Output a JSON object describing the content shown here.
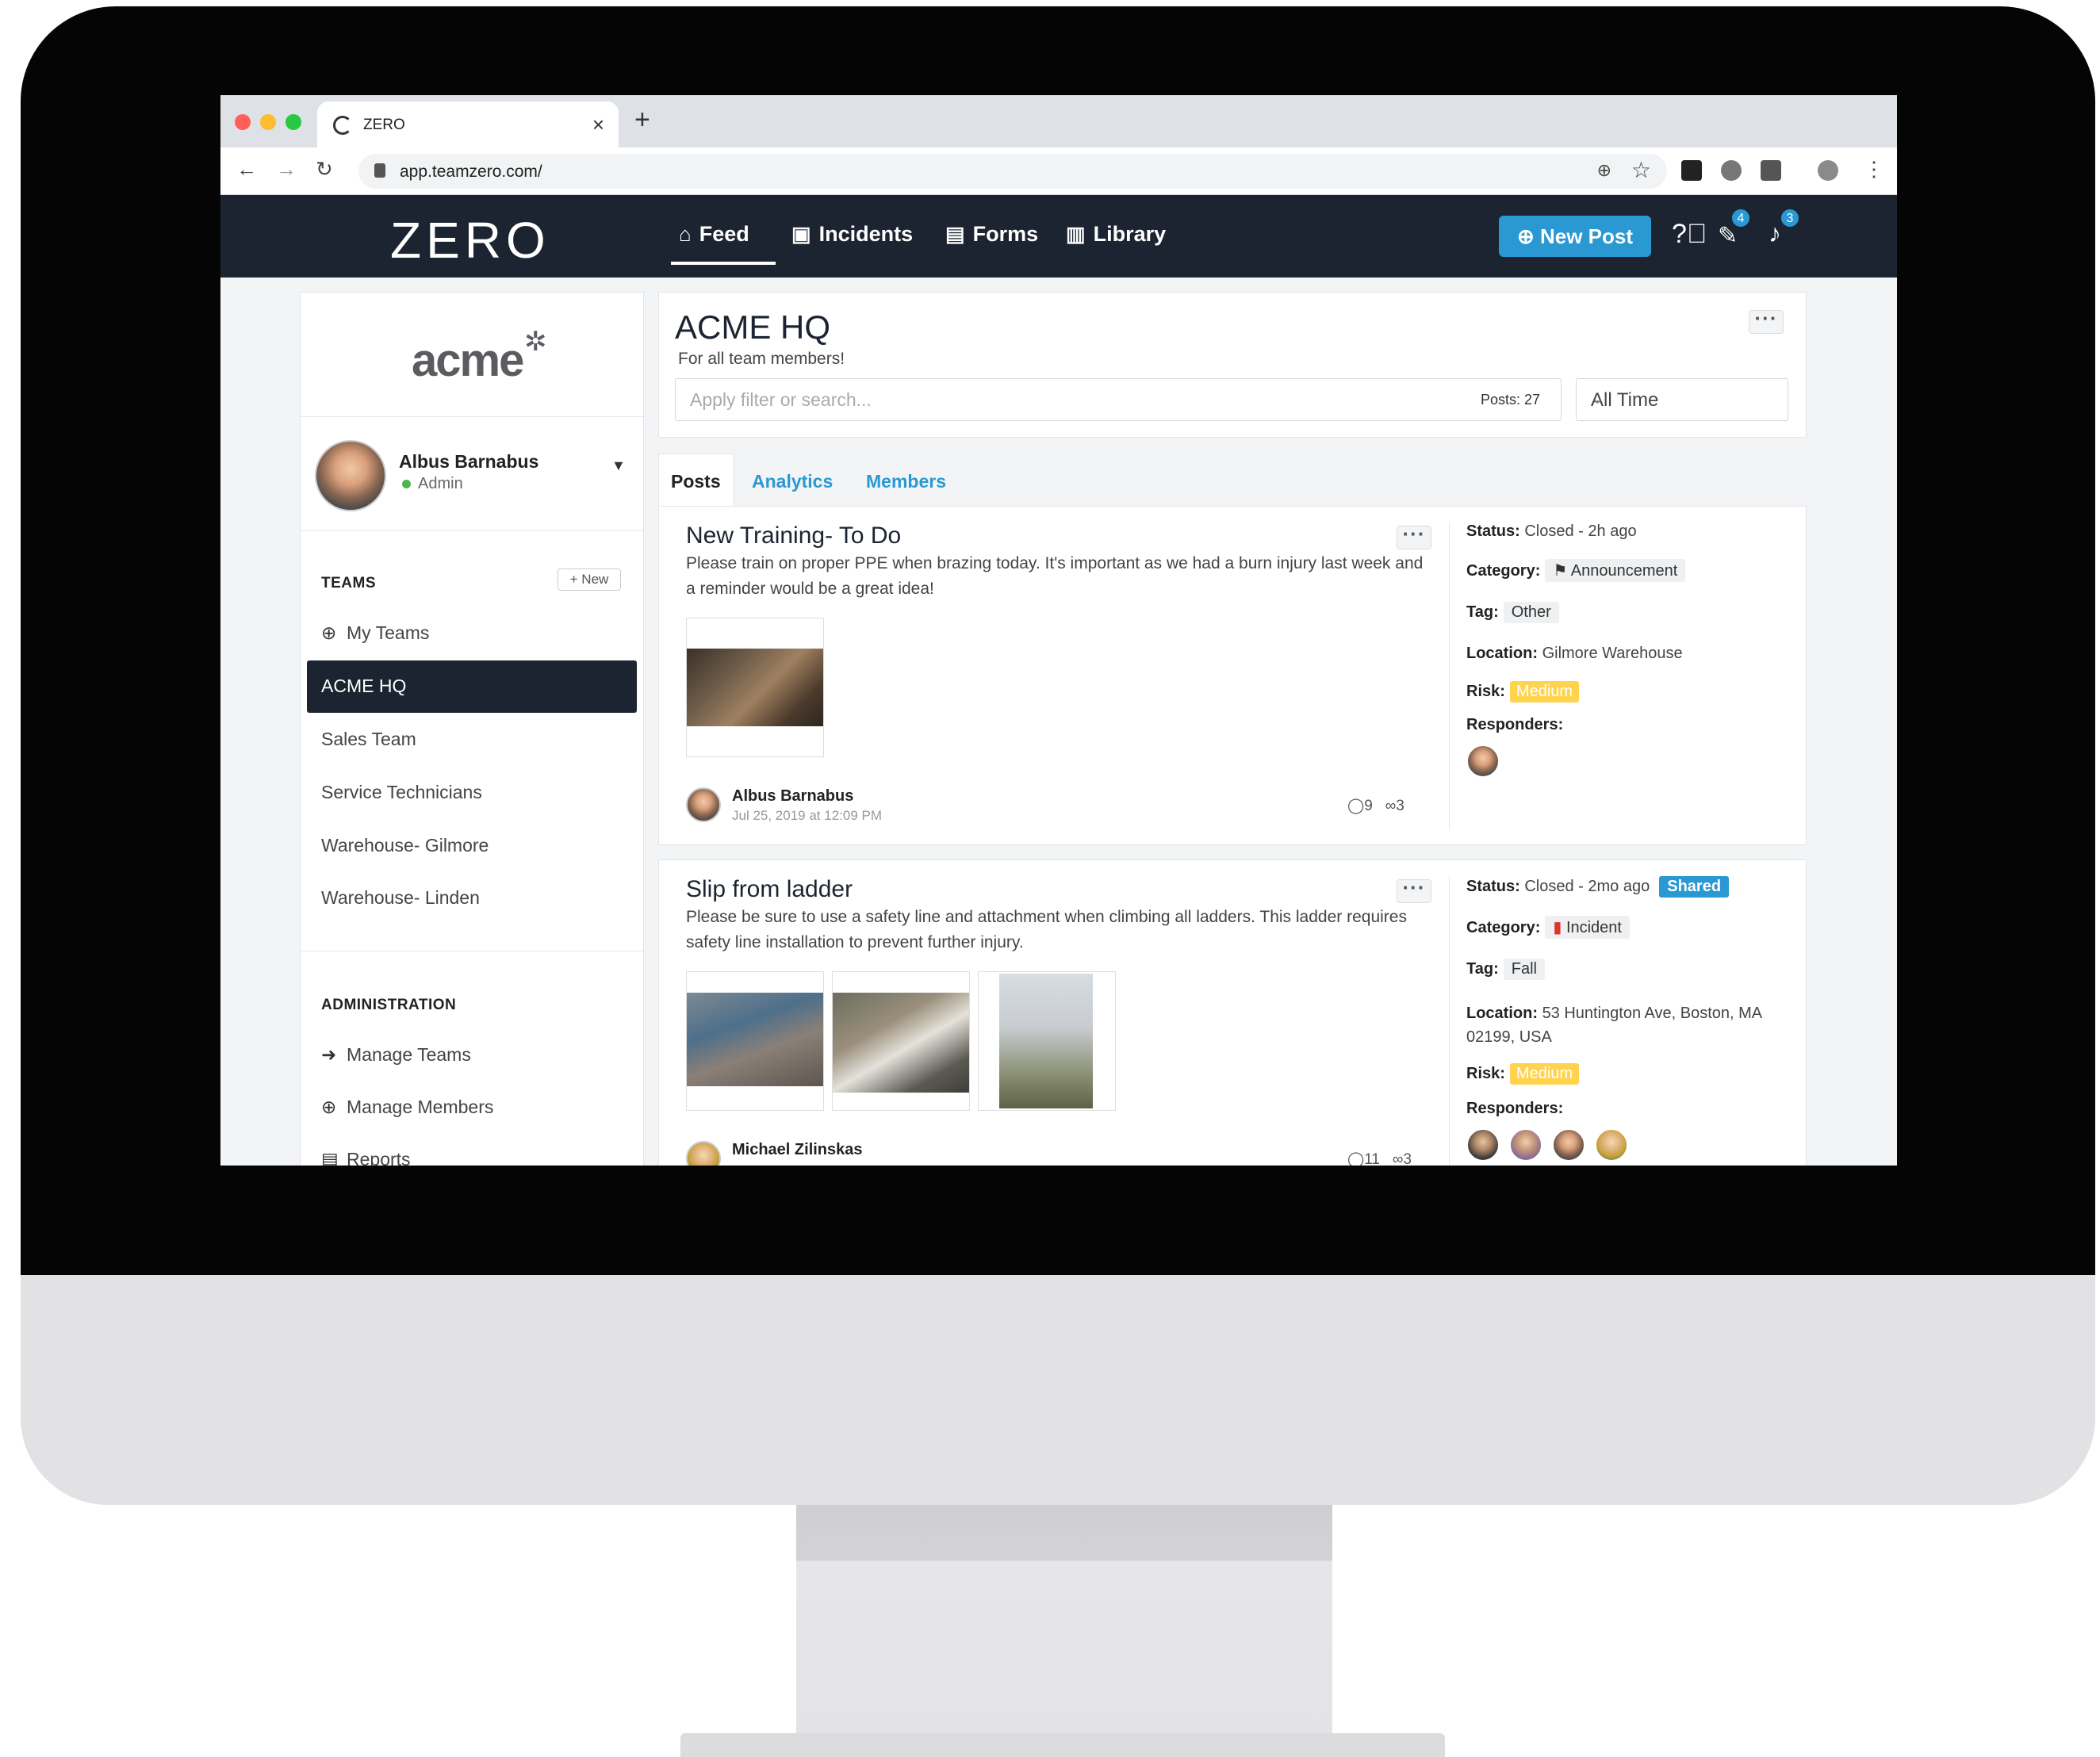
{
  "browser": {
    "tab_title": "ZERO",
    "tab_close": "×",
    "new_tab": "+",
    "url": "app.teamzero.com/",
    "back": "←",
    "forward": "→",
    "reload": "↻",
    "menu": "⋮",
    "colors": {
      "close": "#ff5f57",
      "minimize": "#febc2e",
      "maximize": "#28c840"
    }
  },
  "header": {
    "logo": "ZERO",
    "nav": [
      {
        "label": "Feed",
        "icon": "home-icon"
      },
      {
        "label": "Incidents",
        "icon": "clipboard-icon"
      },
      {
        "label": "Forms",
        "icon": "form-icon"
      },
      {
        "label": "Library",
        "icon": "book-icon"
      }
    ],
    "new_post": "New Post",
    "notification_badge_1": "4",
    "notification_badge_2": "3",
    "accent": "#2a98d3",
    "bar_color": "#1c2431"
  },
  "sidebar": {
    "org_logo": "acme",
    "user": {
      "name": "Albus Barnabus",
      "role": "Admin"
    },
    "teams_title": "TEAMS",
    "new_team": "+ New",
    "my_teams": "My Teams",
    "teams": [
      "ACME HQ",
      "Sales Team",
      "Service Technicians",
      "Warehouse- Gilmore",
      "Warehouse- Linden"
    ],
    "admin_title": "ADMINISTRATION",
    "admin_items": [
      "Manage Teams",
      "Manage Members",
      "Reports"
    ]
  },
  "main": {
    "title": "ACME HQ",
    "subtitle": "For all team members!",
    "search_placeholder": "Apply filter or search...",
    "posts_count": "Posts: 27",
    "time_filter": "All Time",
    "tabs": [
      "Posts",
      "Analytics",
      "Members"
    ]
  },
  "posts": [
    {
      "title": "New Training- To Do",
      "body": "Please train on proper PPE when brazing today. It's important as we had a burn injury last week and a reminder would be a great idea!",
      "author": "Albus Barnabus",
      "date": "Jul 25, 2019 at 12:09 PM",
      "comments": "9",
      "views": "3",
      "status_label": "Status:",
      "status": "Closed - 2h ago",
      "category_label": "Category:",
      "category": "Announcement",
      "tag_label": "Tag:",
      "tag": "Other",
      "location_label": "Location:",
      "location": "Gilmore Warehouse",
      "risk_label": "Risk:",
      "risk": "Medium",
      "responders_label": "Responders:"
    },
    {
      "title": "Slip from ladder",
      "body": "Please be sure to use a safety line and attachment when climbing all ladders. This ladder requires safety line installation to prevent further injury.",
      "author": "Michael Zilinskas",
      "comments": "11",
      "views": "3",
      "status_label": "Status:",
      "status": "Closed - 2mo ago",
      "shared": "Shared",
      "category_label": "Category:",
      "category": "Incident",
      "tag_label": "Tag:",
      "tag": "Fall",
      "location_label": "Location:",
      "location": "53 Huntington Ave, Boston, MA 02199, USA",
      "risk_label": "Risk:",
      "risk": "Medium",
      "responders_label": "Responders:"
    }
  ]
}
